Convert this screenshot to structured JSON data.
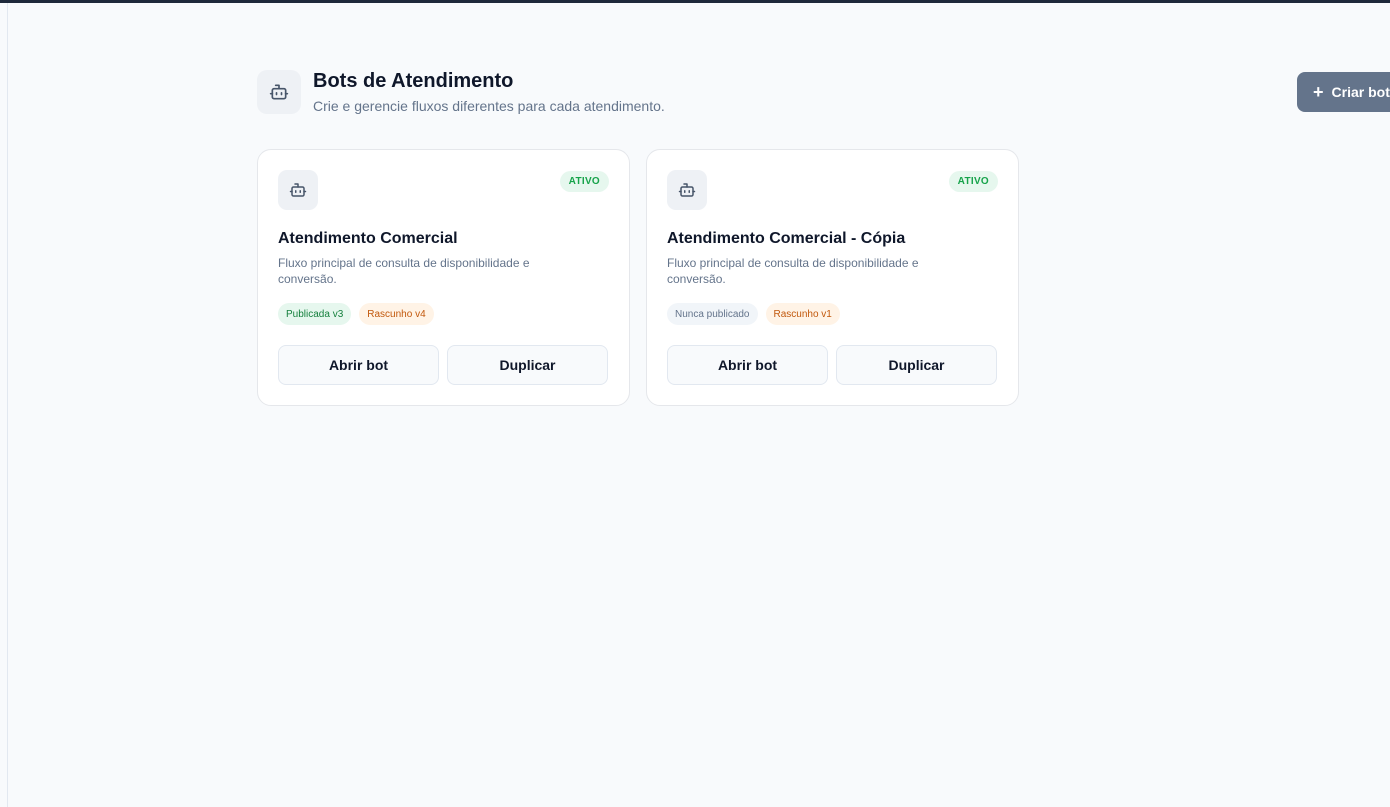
{
  "header": {
    "icon": "bot-icon",
    "title": "Bots de Atendimento",
    "subtitle": "Crie e gerencie fluxos diferentes para cada atendimento."
  },
  "create_button": {
    "icon": "plus-icon",
    "label": "Criar bot"
  },
  "cards": [
    {
      "icon": "bot-icon",
      "status": "ATIVO",
      "title": "Atendimento Comercial",
      "description": "Fluxo principal de consulta de disponibilidade e conversão.",
      "tags": [
        {
          "label": "Publicada v3",
          "color": "#15803d"
        },
        {
          "label": "Rascunho v4",
          "color": "#c2580c"
        }
      ],
      "open_label": "Abrir bot",
      "duplicate_label": "Duplicar"
    },
    {
      "icon": "bot-icon",
      "status": "ATIVO",
      "title": "Atendimento Comercial - Cópia",
      "description": "Fluxo principal de consulta de disponibilidade e conversão.",
      "tags": [
        {
          "label": "Nunca publicado",
          "color": "#64748b"
        },
        {
          "label": "Rascunho v1",
          "color": "#c2580c"
        }
      ],
      "open_label": "Abrir bot",
      "duplicate_label": "Duplicar"
    }
  ]
}
